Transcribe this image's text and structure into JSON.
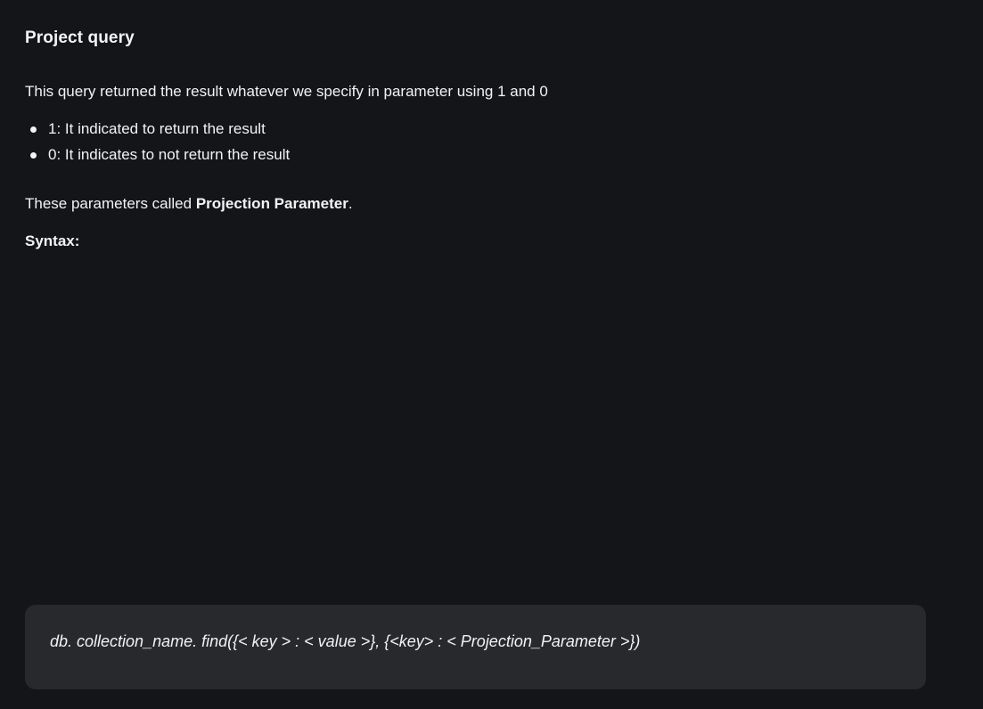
{
  "heading": "Project query",
  "intro": "This query returned the result whatever we specify in parameter using 1 and 0",
  "bullets": [
    "1: It indicated to return the result",
    "0: It indicates to not return the result"
  ],
  "params": {
    "prefix": "These parameters called ",
    "bold": "Projection Parameter",
    "suffix": "."
  },
  "syntax_label": "Syntax:",
  "code": "db. collection_name. find({< key > : < value >}, {<key> : < Projection_Parameter >})",
  "colors": {
    "background": "#141518",
    "code_background": "#28292d",
    "text": "#f2f3f5"
  }
}
